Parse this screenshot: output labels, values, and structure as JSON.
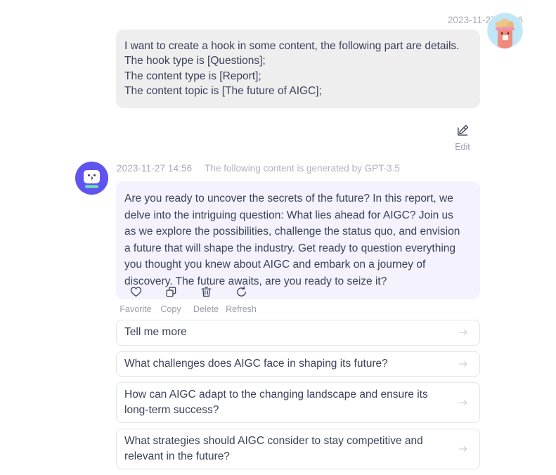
{
  "user_turn": {
    "timestamp": "2023-11-27 14:56",
    "avatar_name": "user-avatar",
    "message_lines": [
      "I want to create a hook in some content, the following part are details.",
      "The hook type is [Questions];",
      "The content type is [Report];",
      "The content topic is [The future of AIGC];"
    ],
    "actions": [
      {
        "icon": "edit-icon",
        "label": "Edit"
      }
    ]
  },
  "assistant_turn": {
    "timestamp": "2023-11-27 14:56",
    "generated_note": "The following content is generated by GPT-3.5",
    "avatar_name": "bot-avatar",
    "message": "Are you ready to uncover the secrets of the future? In this report, we delve into the intriguing question: What lies ahead for AIGC? Join us as we explore the possibilities, challenge the status quo, and envision a future that will shape the industry. Get ready to question everything you thought you knew about AIGC and embark on a journey of discovery. The future awaits, are you ready to seize it?",
    "actions": [
      {
        "icon": "heart-icon",
        "label": "Favorite"
      },
      {
        "icon": "copy-icon",
        "label": "Copy"
      },
      {
        "icon": "trash-icon",
        "label": "Delete"
      },
      {
        "icon": "refresh-icon",
        "label": "Refresh"
      }
    ],
    "suggestions": [
      {
        "text": "Tell me more",
        "arrow_icon": "arrow-right-icon"
      },
      {
        "text": "What challenges does AIGC face in shaping its future?",
        "arrow_icon": "arrow-right-icon"
      },
      {
        "text": "How can AIGC adapt to the changing landscape and ensure its long-term success?",
        "arrow_icon": "arrow-right-icon"
      },
      {
        "text": "What strategies should AIGC consider to stay competitive and relevant in the future?",
        "arrow_icon": "arrow-right-icon"
      }
    ]
  },
  "colors": {
    "user_bubble_bg": "#eeeeef",
    "assistant_bubble_bg": "#f3f2fd",
    "bot_avatar_bg": "#6054f0",
    "text_primary": "#3d425a",
    "text_muted": "#a9aab5",
    "suggestion_border": "#e4e5ea"
  }
}
